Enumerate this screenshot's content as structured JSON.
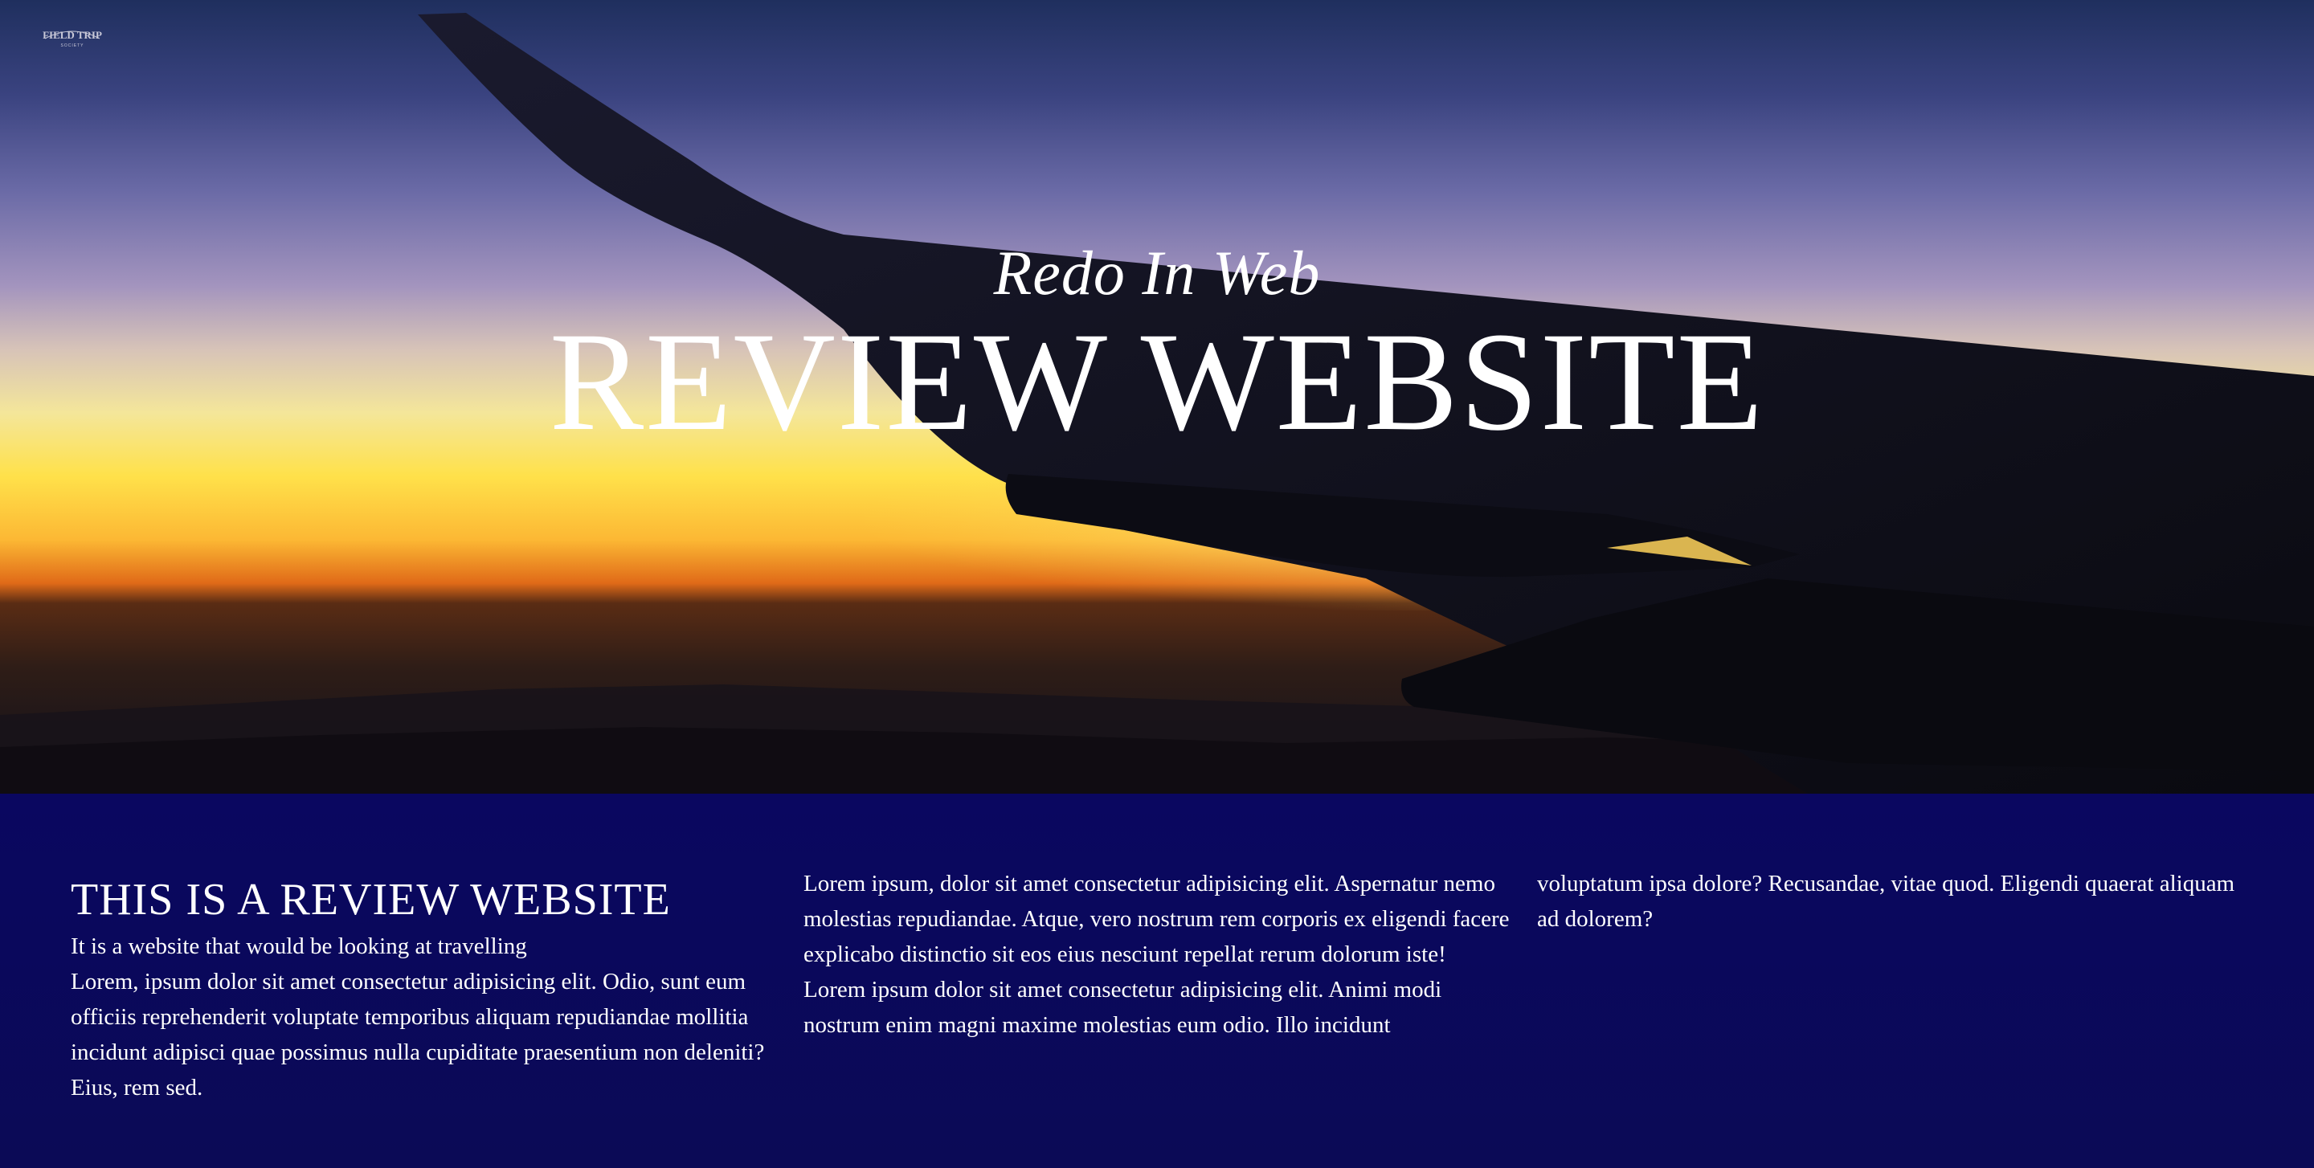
{
  "logo": {
    "text": "FIELD TRIP",
    "subtext": "SOCIETY"
  },
  "hero": {
    "subtitle": "Redo In Web",
    "title": "REVIEW WEBSITE"
  },
  "section": {
    "heading": "THIS IS A REVIEW WEBSITE",
    "intro": "It is a website that would be looking at travelling",
    "paragraph_1": "Lorem, ipsum dolor sit amet consectetur adipisicing elit. Odio, sunt eum officiis reprehenderit voluptate temporibus aliquam repudiandae mollitia incidunt adipisci quae possimus nulla cupiditate praesentium non deleniti? Eius, rem sed.",
    "paragraph_2": "Lorem ipsum, dolor sit amet consectetur adipisicing elit. Aspernatur nemo molestias repudiandae. Atque, vero nostrum rem corporis ex eligendi facere explicabo distinctio sit eos eius nesciunt repellat rerum dolorum iste!",
    "paragraph_3_start": "Lorem ipsum dolor sit amet consectetur adipisicing elit. Animi modi nostrum enim magni maxime molestias eum odio. Illo incidunt",
    "paragraph_3_end": "voluptatum ipsa dolore? Recusandae, vitae quod. Eligendi quaerat aliquam ad dolorem?"
  },
  "colors": {
    "content_background": "#0a0760",
    "text": "#ffffff"
  }
}
